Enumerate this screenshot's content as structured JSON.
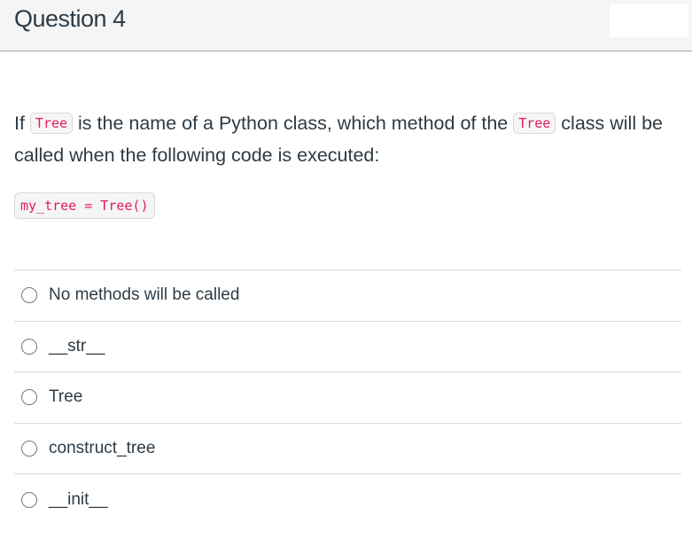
{
  "header": {
    "title": "Question 4"
  },
  "question": {
    "text_part1": "If ",
    "code1": "Tree",
    "text_part2": " is the name of a Python class, which method of the ",
    "code2": "Tree",
    "text_part3": " class will be called when the following code is executed:",
    "code_block": "my_tree = Tree()"
  },
  "answers": [
    {
      "label": "No methods will be called",
      "selected": false
    },
    {
      "label": "__str__",
      "selected": false
    },
    {
      "label": "Tree",
      "selected": false
    },
    {
      "label": "construct_tree",
      "selected": false
    },
    {
      "label": "__init__",
      "selected": false
    }
  ],
  "colors": {
    "code_text": "#e01e5a",
    "body_text": "#2d3b45",
    "header_bg": "#f5f5f5"
  }
}
